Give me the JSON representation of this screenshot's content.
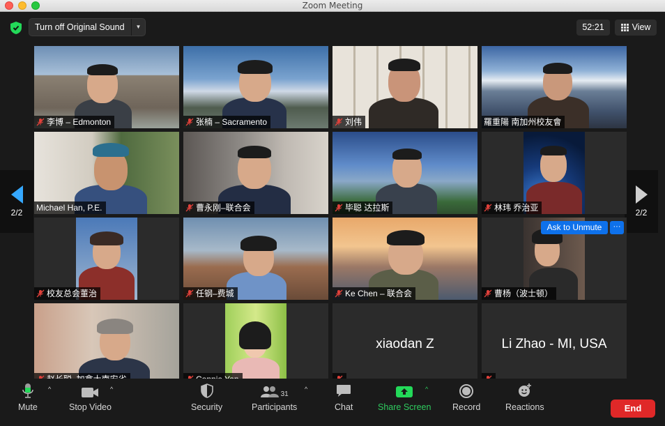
{
  "window": {
    "title": "Zoom Meeting"
  },
  "topbar": {
    "sound_button": "Turn off Original Sound",
    "timer": "52:21",
    "view_label": "View"
  },
  "nav": {
    "page_left": "2/2",
    "page_right": "2/2"
  },
  "participants": [
    {
      "name": "李博 – Edmonton",
      "muted": true
    },
    {
      "name": "张楠 – Sacramento",
      "muted": true
    },
    {
      "name": "刘伟",
      "muted": true
    },
    {
      "name": "羅重陽 南加州校友會",
      "muted": false
    },
    {
      "name": "Michael Han, P.E.",
      "muted": false
    },
    {
      "name": "曹永刚–联合会",
      "muted": true
    },
    {
      "name": "毕聪 达拉斯",
      "muted": true
    },
    {
      "name": "林玮 乔治亚",
      "muted": true
    },
    {
      "name": "校友总会董治",
      "muted": true
    },
    {
      "name": "任钢–费城",
      "muted": true
    },
    {
      "name": "Ke Chen – 联合会",
      "muted": true
    },
    {
      "name": "曹杨（波士顿）",
      "muted": true
    },
    {
      "name": "赵长聪–加拿大南安省",
      "muted": true
    },
    {
      "name": "Connie Yan",
      "muted": true
    },
    {
      "name": "xiaodan Z",
      "muted": true
    },
    {
      "name": "Li Zhao - MI, USA",
      "muted": true
    }
  ],
  "hover_actions": {
    "ask_unmute": "Ask to Unmute",
    "more": "···"
  },
  "toolbar": {
    "mute": "Mute",
    "stop_video": "Stop Video",
    "security": "Security",
    "participants": "Participants",
    "participants_count": "31",
    "chat": "Chat",
    "share_screen": "Share Screen",
    "record": "Record",
    "reactions": "Reactions",
    "end": "End"
  },
  "colors": {
    "accent_blue": "#0e71eb",
    "share_green": "#2fcc5f",
    "end_red": "#e02828",
    "muted_red": "#e0403a"
  }
}
